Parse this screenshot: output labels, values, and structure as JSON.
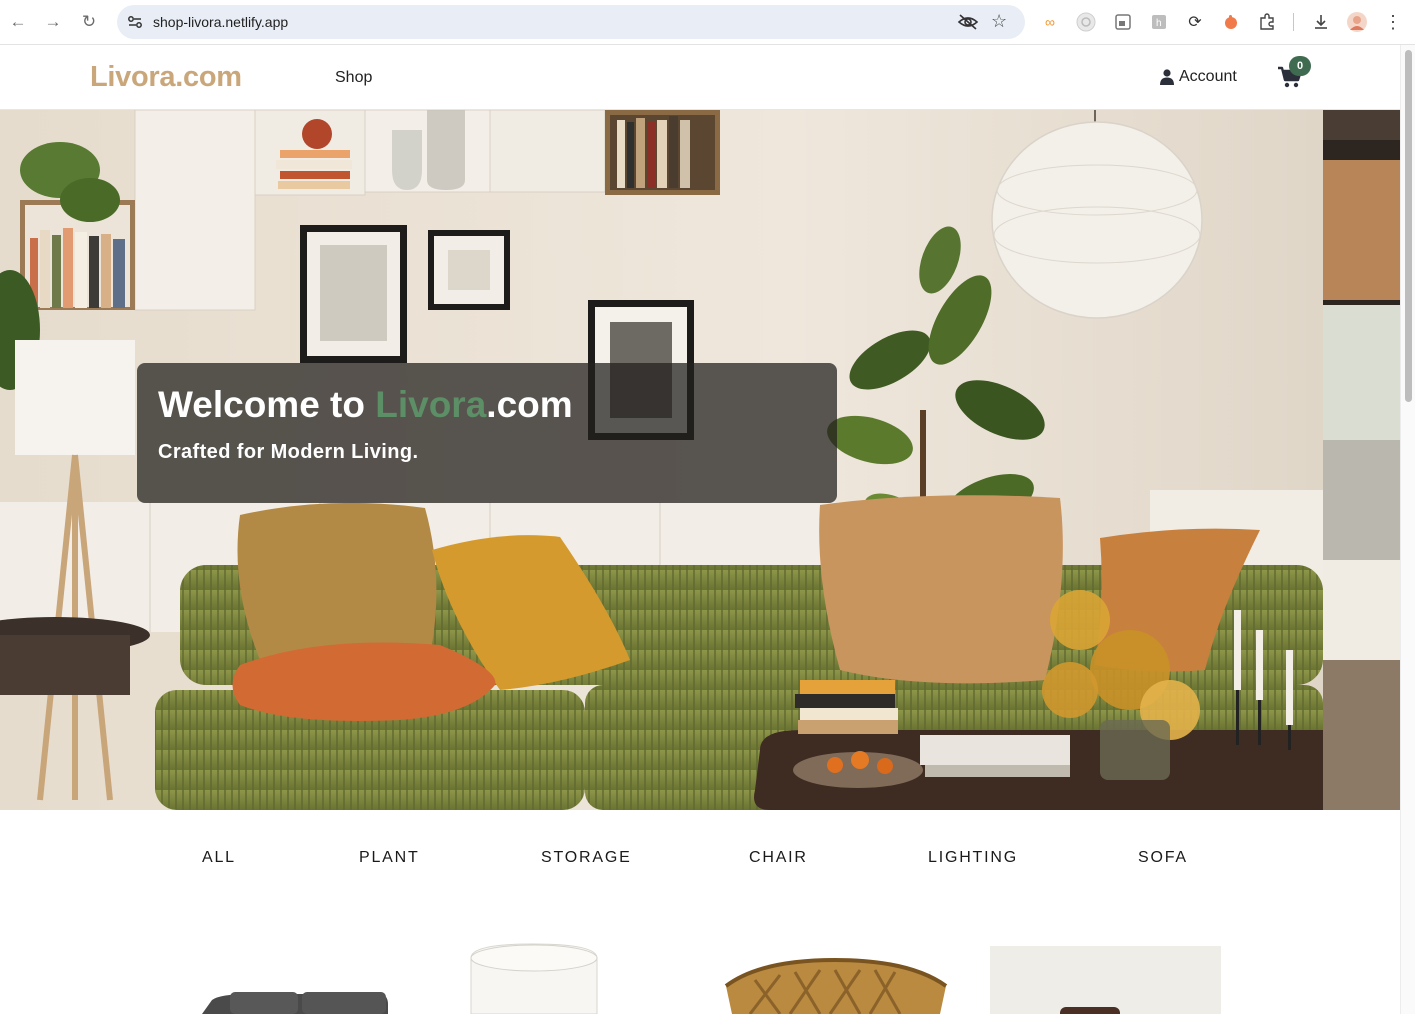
{
  "browser": {
    "url": "shop-livora.netlify.app",
    "icons": [
      "back-icon",
      "forward-icon",
      "reload-icon",
      "site-settings-icon",
      "eye-off-icon",
      "bookmark-star-icon",
      "extensions-icon",
      "download-icon",
      "profile-avatar",
      "menu-kebab-icon"
    ]
  },
  "header": {
    "logo": "Livora.com",
    "nav_shop": "Shop",
    "account_label": "Account",
    "cart_count": "0",
    "colors": {
      "logo": "#c9a77a",
      "badge": "#3f6b50"
    }
  },
  "hero": {
    "title_prefix": "Welcome to ",
    "title_accent": "Livora",
    "title_suffix": ".com",
    "subtitle": "Crafted for Modern Living.",
    "colors": {
      "accent": "#5c8f66"
    }
  },
  "categories": [
    {
      "label": "ALL"
    },
    {
      "label": "PLANT"
    },
    {
      "label": "STORAGE"
    },
    {
      "label": "CHAIR"
    },
    {
      "label": "LIGHTING"
    },
    {
      "label": "SOFA"
    }
  ]
}
